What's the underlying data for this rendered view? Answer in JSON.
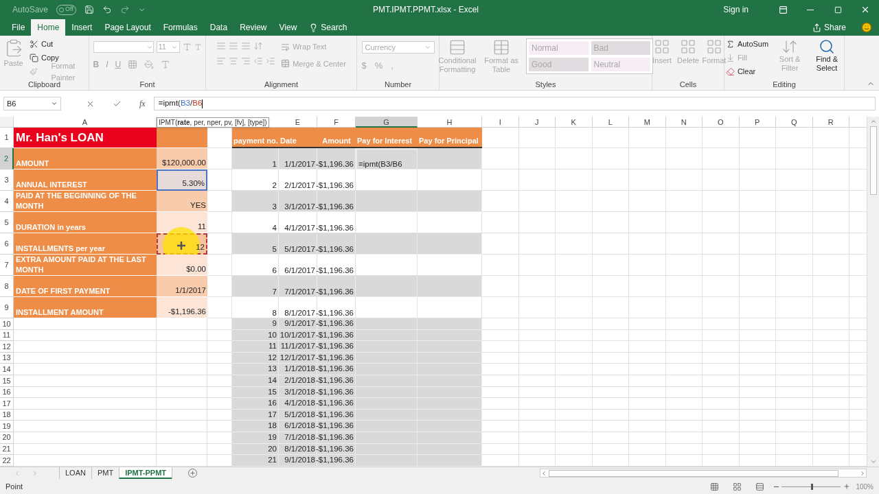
{
  "title_bar": {
    "autosave": "AutoSave",
    "autosave_state": "Off",
    "autosave_on": false,
    "title": "PMT.IPMT.PPMT.xlsx  -  Excel",
    "sign_in": "Sign in"
  },
  "ribbon_tabs": [
    {
      "label": "File",
      "selected": false
    },
    {
      "label": "Home",
      "selected": true
    },
    {
      "label": "Insert",
      "selected": false
    },
    {
      "label": "Page Layout",
      "selected": false
    },
    {
      "label": "Formulas",
      "selected": false
    },
    {
      "label": "Data",
      "selected": false
    },
    {
      "label": "Review",
      "selected": false
    },
    {
      "label": "View",
      "selected": false
    }
  ],
  "search": "Search",
  "share": "Share",
  "ribbon_groups": [
    {
      "kind": "clipboard",
      "label": "Clipboard",
      "items": [
        {
          "label": "Paste",
          "disabled": true
        },
        {
          "label": "Cut",
          "disabled": false
        },
        {
          "label": "Copy",
          "disabled": false
        },
        {
          "label": "Format Painter",
          "disabled": true
        }
      ]
    },
    {
      "kind": "font",
      "label": "Font",
      "font_size": "11",
      "items": [
        {
          "label": "B"
        },
        {
          "label": "I"
        },
        {
          "label": "U"
        }
      ]
    },
    {
      "kind": "alignment",
      "label": "Alignment",
      "items": [
        {
          "label": "Wrap Text"
        },
        {
          "label": "Merge & Center"
        }
      ]
    },
    {
      "kind": "number",
      "label": "Number",
      "format": "Currency",
      "items": [
        {
          "label": "$"
        },
        {
          "label": "%"
        },
        {
          "label": ","
        }
      ]
    },
    {
      "kind": "styles",
      "label": "Styles",
      "items": [
        {
          "label": "Conditional Formatting"
        },
        {
          "label": "Format as Table"
        }
      ],
      "cell_styles": [
        {
          "label": "Normal",
          "color": "#f6eef4"
        },
        {
          "label": "Bad",
          "color": "#e0dcdf"
        },
        {
          "label": "Good",
          "color": "#e0dcdf"
        },
        {
          "label": "Neutral",
          "color": "#f6eef4"
        }
      ]
    },
    {
      "kind": "cells",
      "label": "Cells",
      "items": [
        {
          "label": "Insert"
        },
        {
          "label": "Delete"
        },
        {
          "label": "Format"
        }
      ]
    },
    {
      "kind": "editing",
      "label": "Editing",
      "items": [
        {
          "label": "AutoSum",
          "disabled": false
        },
        {
          "label": "Fill",
          "disabled": true
        },
        {
          "label": "Clear",
          "disabled": false
        },
        {
          "label": "Sort & Filter",
          "disabled": true
        },
        {
          "label": "Find & Select",
          "disabled": false
        }
      ]
    }
  ],
  "formula_bar": {
    "name_box": "B6",
    "function_label": "fx",
    "parts": [
      {
        "text": "=ipmt("
      },
      {
        "text": "B3",
        "color": "#3f6fc4"
      },
      {
        "text": "/"
      },
      {
        "text": "B6",
        "color": "#c0392b"
      }
    ]
  },
  "tooltip": "IPMT(**rate**, per, nper, pv, [fv], [type])",
  "column_headers": [
    {
      "letter": "A",
      "selected": false
    },
    {
      "letter": "E",
      "selected": false
    },
    {
      "letter": "F",
      "selected": false
    },
    {
      "letter": "G",
      "selected": true
    },
    {
      "letter": "H",
      "selected": false
    },
    {
      "letter": "I",
      "selected": false
    },
    {
      "letter": "J",
      "selected": false
    },
    {
      "letter": "K",
      "selected": false
    },
    {
      "letter": "L",
      "selected": false
    },
    {
      "letter": "M",
      "selected": false
    },
    {
      "letter": "N",
      "selected": false
    },
    {
      "letter": "O",
      "selected": false
    },
    {
      "letter": "P",
      "selected": false
    },
    {
      "letter": "Q",
      "selected": false
    },
    {
      "letter": "R",
      "selected": false
    }
  ],
  "row_headers": [
    {
      "label": "1",
      "selected": false
    },
    {
      "label": "2",
      "selected": true
    },
    {
      "label": "3",
      "selected": false
    },
    {
      "label": "4",
      "selected": false
    },
    {
      "label": "5",
      "selected": false
    },
    {
      "label": "6",
      "selected": false
    },
    {
      "label": "7",
      "selected": false
    },
    {
      "label": "8",
      "selected": false
    },
    {
      "label": "9",
      "selected": false
    },
    {
      "label": "10",
      "selected": false
    },
    {
      "label": "11",
      "selected": false
    },
    {
      "label": "12",
      "selected": false
    },
    {
      "label": "13",
      "selected": false
    },
    {
      "label": "14",
      "selected": false
    },
    {
      "label": "15",
      "selected": false
    },
    {
      "label": "16",
      "selected": false
    },
    {
      "label": "17",
      "selected": false
    },
    {
      "label": "18",
      "selected": false
    },
    {
      "label": "19",
      "selected": false
    },
    {
      "label": "20",
      "selected": false
    },
    {
      "label": "21",
      "selected": false
    },
    {
      "label": "22",
      "selected": false
    }
  ],
  "loan": {
    "title": "Mr. Han's LOAN",
    "items": [
      {
        "label": "AMOUNT",
        "value": "$120,000.00",
        "referenced": false,
        "marquee": false
      },
      {
        "label": "ANNUAL INTEREST",
        "value": "5.30%",
        "referenced": true,
        "marquee": false
      },
      {
        "label": "PAID AT THE BEGINNING OF THE MONTH",
        "value": "YES",
        "referenced": false,
        "marquee": false
      },
      {
        "label": "DURATION in years",
        "value": "11",
        "referenced": false,
        "marquee": false
      },
      {
        "label": "INSTALLMENTS per year",
        "value": "12",
        "referenced": false,
        "marquee": true
      },
      {
        "label": "EXTRA AMOUNT PAID AT THE LAST MONTH",
        "value": "$0.00",
        "referenced": false,
        "marquee": false
      },
      {
        "label": "DATE OF FIRST PAYMENT",
        "value": "1/1/2017",
        "referenced": false,
        "marquee": false
      },
      {
        "label": "INSTALLMENT AMOUNT",
        "value": "-$1,196.36",
        "referenced": false,
        "marquee": false
      }
    ]
  },
  "payments": {
    "columns": [
      "payment no.",
      "Date",
      "Amount",
      "Pay for Interest",
      "Pay for Principal"
    ],
    "rows": [
      {
        "no": "1",
        "date": "1/1/2017",
        "amount": "-$1,196.36",
        "interest": "=ipmt(B3/B6",
        "selected": true
      },
      {
        "no": "2",
        "date": "2/1/2017",
        "amount": "-$1,196.36",
        "selected": false
      },
      {
        "no": "3",
        "date": "3/1/2017",
        "amount": "-$1,196.36",
        "selected": false
      },
      {
        "no": "4",
        "date": "4/1/2017",
        "amount": "-$1,196.36",
        "selected": false
      },
      {
        "no": "5",
        "date": "5/1/2017",
        "amount": "-$1,196.36",
        "selected": false
      },
      {
        "no": "6",
        "date": "6/1/2017",
        "amount": "-$1,196.36",
        "selected": false
      },
      {
        "no": "7",
        "date": "7/1/2017",
        "amount": "-$1,196.36",
        "selected": false
      },
      {
        "no": "8",
        "date": "8/1/2017",
        "amount": "-$1,196.36",
        "selected": false
      },
      {
        "no": "9",
        "date": "9/1/2017",
        "amount": "-$1,196.36",
        "selected": false
      },
      {
        "no": "10",
        "date": "10/1/2017",
        "amount": "-$1,196.36",
        "selected": false
      },
      {
        "no": "11",
        "date": "11/1/2017",
        "amount": "-$1,196.36",
        "selected": false
      },
      {
        "no": "12",
        "date": "12/1/2017",
        "amount": "-$1,196.36",
        "selected": false
      },
      {
        "no": "13",
        "date": "1/1/2018",
        "amount": "-$1,196.36",
        "selected": false
      },
      {
        "no": "14",
        "date": "2/1/2018",
        "amount": "-$1,196.36",
        "selected": false
      },
      {
        "no": "15",
        "date": "3/1/2018",
        "amount": "-$1,196.36",
        "selected": false
      },
      {
        "no": "16",
        "date": "4/1/2018",
        "amount": "-$1,196.36",
        "selected": false
      },
      {
        "no": "17",
        "date": "5/1/2018",
        "amount": "-$1,196.36",
        "selected": false
      },
      {
        "no": "18",
        "date": "6/1/2018",
        "amount": "-$1,196.36",
        "selected": false
      },
      {
        "no": "19",
        "date": "7/1/2018",
        "amount": "-$1,196.36",
        "selected": false
      },
      {
        "no": "20",
        "date": "8/1/2018",
        "amount": "-$1,196.36",
        "selected": false
      },
      {
        "no": "21",
        "date": "9/1/2018",
        "amount": "-$1,196.36",
        "selected": false
      }
    ]
  },
  "sheet_tabs": [
    {
      "label": "LOAN",
      "selected": false
    },
    {
      "label": "PMT",
      "selected": false
    },
    {
      "label": "IPMT-PPMT",
      "selected": true
    }
  ],
  "status_bar": {
    "mode": "Point",
    "zoom": "100%",
    "zoom_slider": {
      "level": 0.5
    }
  }
}
